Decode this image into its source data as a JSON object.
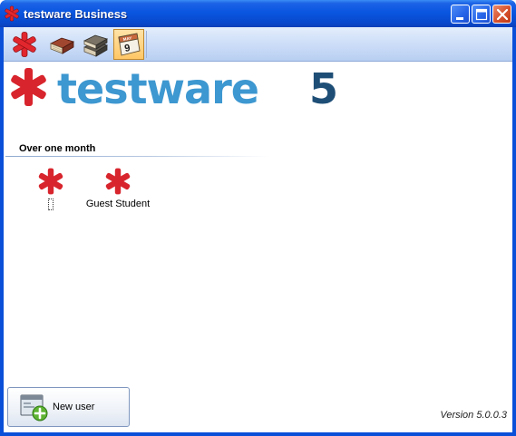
{
  "window": {
    "title": "testware Business",
    "controls": [
      "minimize",
      "maximize",
      "close"
    ]
  },
  "toolbar": {
    "items": [
      {
        "name": "testware-home-icon",
        "active": false
      },
      {
        "name": "book-icon",
        "active": false
      },
      {
        "name": "book-stack-icon",
        "active": false
      },
      {
        "name": "calendar-icon",
        "active": true,
        "day": "9",
        "month_abbr": "MAY"
      }
    ]
  },
  "logo": {
    "brand_word": "testware",
    "brand_number": "5",
    "color_word": "#3d97d0",
    "color_number": "#1e4e76",
    "color_asterisk": "#d8252d"
  },
  "users_section": {
    "title": "Over one month",
    "users": [
      {
        "name": "",
        "focused": true
      },
      {
        "name": "Guest Student",
        "focused": false
      }
    ]
  },
  "new_user_button": {
    "label": "New user"
  },
  "footer": {
    "version": "Version 5.0.0.3"
  }
}
